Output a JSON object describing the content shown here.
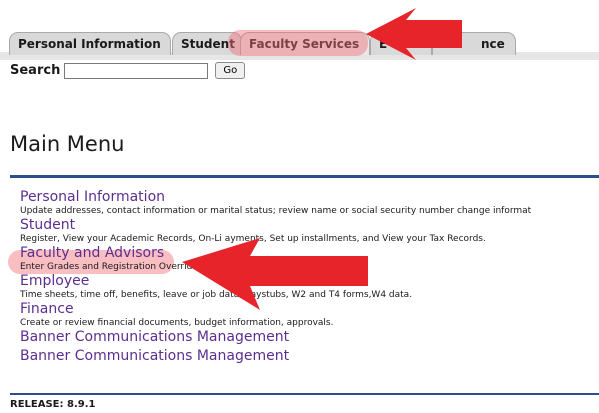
{
  "tabs": [
    {
      "label": "Personal Information"
    },
    {
      "label": "Student"
    },
    {
      "label": "Faculty Services"
    },
    {
      "label": "E"
    },
    {
      "label": "nce"
    }
  ],
  "search": {
    "label": "Search",
    "value": "",
    "go_label": "Go"
  },
  "page_title": "Main Menu",
  "menu": [
    {
      "label": "Personal Information",
      "description": "Update addresses, contact information or marital status; review name or social security number change informat"
    },
    {
      "label": "Student",
      "description": "Register, View your Academic Records, On-Li ayments, Set up installments, and View your Tax Records."
    },
    {
      "label": "Faculty and Advisors",
      "description": "Enter Grades and Registration Overrides, Vi Student Information"
    },
    {
      "label": "Employee",
      "description": "Time sheets, time off, benefits, leave or job data, paystubs, W2 and T4 forms,W4 data."
    },
    {
      "label": "Finance",
      "description": "Create or review financial documents, budget information, approvals."
    },
    {
      "label": "Banner Communications Management"
    },
    {
      "label": "Banner Communications Management"
    }
  ],
  "release": "RELEASE: 8.9.1",
  "colors": {
    "link": "#5b2f8f",
    "rule": "#2b4f8a",
    "annotation": "#e8242b",
    "highlight": "#f06e78"
  }
}
